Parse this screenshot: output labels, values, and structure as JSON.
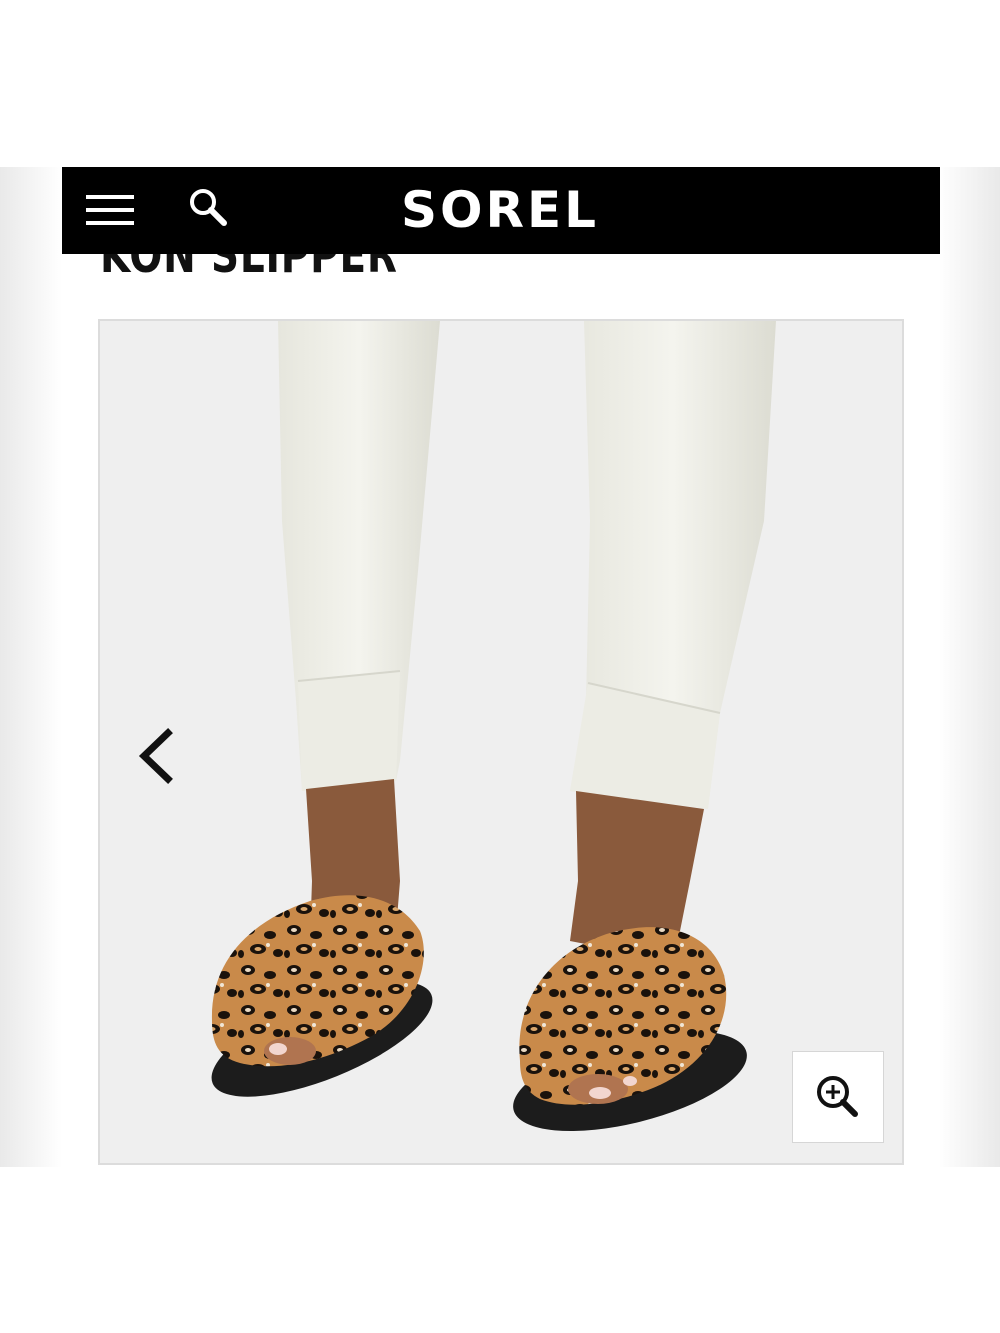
{
  "header": {
    "brand": "SOREL",
    "menu_icon": "hamburger-menu-icon",
    "search_icon": "search-icon",
    "background_color": "#000000",
    "text_color": "#ffffff"
  },
  "product": {
    "title": "KON SLIPPER",
    "image_description": "leopard-print-faux-fur-slippers-on-model-white-pants"
  },
  "gallery": {
    "prev_icon": "chevron-left-icon",
    "zoom_icon": "zoom-in-icon",
    "background_color": "#efefef"
  }
}
